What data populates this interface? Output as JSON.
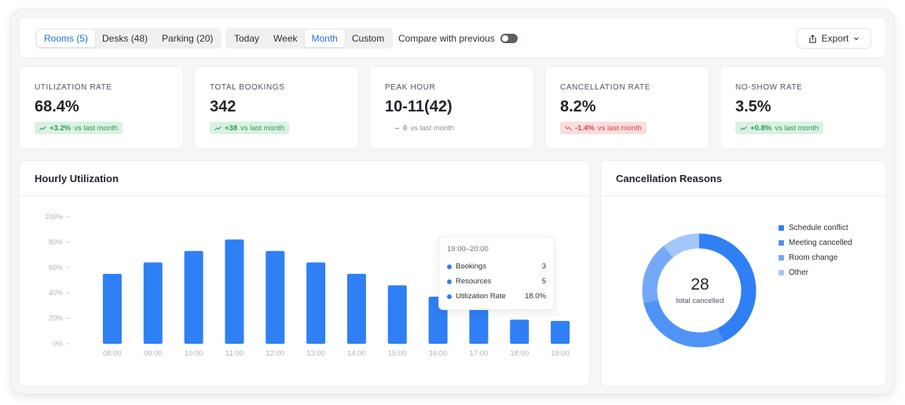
{
  "toolbar": {
    "resource_tabs": [
      {
        "label": "Rooms (5)",
        "active": true
      },
      {
        "label": "Desks (48)",
        "active": false
      },
      {
        "label": "Parking (20)",
        "active": false
      }
    ],
    "period_tabs": [
      {
        "label": "Today",
        "active": false
      },
      {
        "label": "Week",
        "active": false
      },
      {
        "label": "Month",
        "active": true
      },
      {
        "label": "Custom",
        "active": false
      }
    ],
    "compare_label": "Compare with previous",
    "compare_enabled": false,
    "export_label": "Export"
  },
  "kpis": [
    {
      "label": "UTILIZATION RATE",
      "value": "68.4%",
      "delta": "+3.2%",
      "delta_text": "vs last month",
      "trend": "up"
    },
    {
      "label": "TOTAL BOOKINGS",
      "value": "342",
      "delta": "+38",
      "delta_text": "vs last month",
      "trend": "up"
    },
    {
      "label": "PEAK HOUR",
      "value": "10-11(42)",
      "delta": "0",
      "delta_text": "vs last month",
      "trend": "flat"
    },
    {
      "label": "CANCELLATION RATE",
      "value": "8.2%",
      "delta": "-1.4%",
      "delta_text": "vs last month",
      "trend": "down"
    },
    {
      "label": "NO-SHOW RATE",
      "value": "3.5%",
      "delta": "+0.8%",
      "delta_text": "vs last month",
      "trend": "up"
    }
  ],
  "hourly": {
    "title": "Hourly Utilization",
    "tooltip": {
      "title": "19:00–20:00",
      "rows": [
        {
          "label": "Bookings",
          "value": "3"
        },
        {
          "label": "Resources",
          "value": "5"
        },
        {
          "label": "Utilization Rate",
          "value": "18.0%"
        }
      ]
    }
  },
  "cancellation": {
    "title": "Cancellation Reasons",
    "total": "28",
    "total_label": "total cancelled",
    "legend": [
      {
        "label": "Schedule conflict",
        "color": "#2f7ff5"
      },
      {
        "label": "Meeting cancelled",
        "color": "#4f93f7"
      },
      {
        "label": "Room change",
        "color": "#73a9f8"
      },
      {
        "label": "Other",
        "color": "#a3c6fb"
      }
    ]
  },
  "chart_data": [
    {
      "type": "bar",
      "categories": [
        "08:00",
        "09:00",
        "10:00",
        "11:00",
        "12:00",
        "13:00",
        "14:00",
        "15:00",
        "16:00",
        "17:00",
        "18:00",
        "19:00"
      ],
      "values": [
        55,
        64,
        73,
        82,
        73,
        64,
        55,
        46,
        37,
        28,
        19,
        18
      ],
      "ylim": [
        0,
        100
      ],
      "yticks": [
        "0%",
        "20%",
        "40%",
        "60%",
        "80%",
        "100%"
      ],
      "color": "#2f7ff5"
    },
    {
      "type": "pie",
      "categories": [
        "Schedule conflict",
        "Meeting cancelled",
        "Room change",
        "Other"
      ],
      "values": [
        12,
        8,
        5,
        3
      ],
      "colors": [
        "#2f7ff5",
        "#4f93f7",
        "#73a9f8",
        "#a3c6fb"
      ]
    }
  ]
}
